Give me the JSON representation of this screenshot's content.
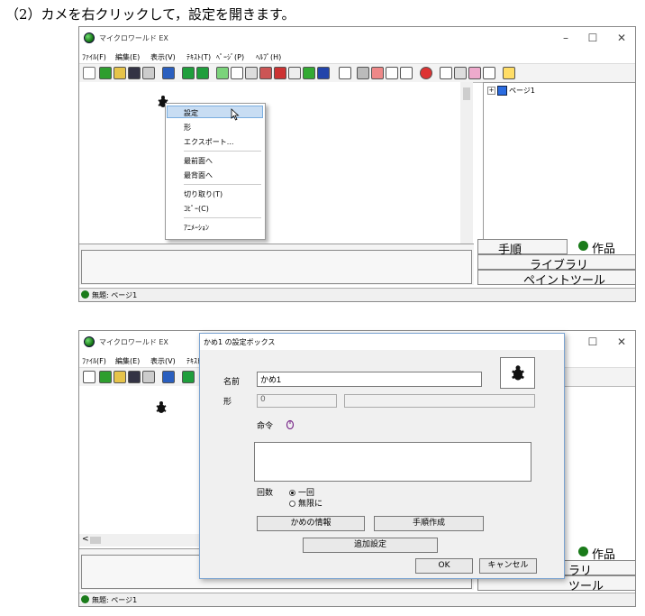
{
  "caption": "（2）カメを右クリックして，設定を開きます。",
  "app": {
    "title": "マイクロワールド EX",
    "menus": [
      "ﾌｧｲﾙ(F)",
      "編集(E)",
      "表示(V)",
      "ﾃｷｽﾄ(T)",
      "ﾍﾟｰｼﾞ(P)",
      "ﾍﾙﾌﾟ(H)"
    ],
    "window_controls": {
      "minimize": "–",
      "maximize": "☐",
      "close": "✕"
    },
    "tree_item": "ページ1",
    "tabs": {
      "procedures": "手順",
      "works": "作品",
      "library": "ライブラリ",
      "paint_tools": "ペイントツール"
    },
    "status_text": "無題: ページ1"
  },
  "context_menu": {
    "items": [
      "設定",
      "形",
      "エクスポート...",
      "最前面へ",
      "最背面へ",
      "切り取り(T)",
      "ｺﾋﾟｰ(C)",
      "ｱﾆﾒｰｼｮﾝ"
    ],
    "highlighted": "設定"
  },
  "app2": {
    "title": "マイクロワールド EX",
    "menus_visible": [
      "ﾌｧｲﾙ(F)",
      "編集(E)",
      "表示(V)",
      "ﾃｷｽﾄ("
    ],
    "tab_fragments": {
      "works": "作品",
      "library": "ラリ",
      "paint_tools": "ツール"
    },
    "status_text": "無題: ページ1"
  },
  "dialog": {
    "title": "かめ1 の設定ボックス",
    "name_label": "名前",
    "name_value": "かめ1",
    "shape_label": "形",
    "shape_value": "0",
    "command_label": "命令",
    "count_label": "回数",
    "radio_once": "一回",
    "radio_infinite": "無限に",
    "turtle_info_button": "かめの情報",
    "procedure_button": "手順作成",
    "extra_settings_button": "追加設定",
    "ok_button": "OK",
    "cancel_button": "キャンセル"
  },
  "colors": {
    "highlight": "#c8ddf3",
    "dialog_border": "#7aa3d1",
    "icon_green": "#1a7b1a"
  }
}
